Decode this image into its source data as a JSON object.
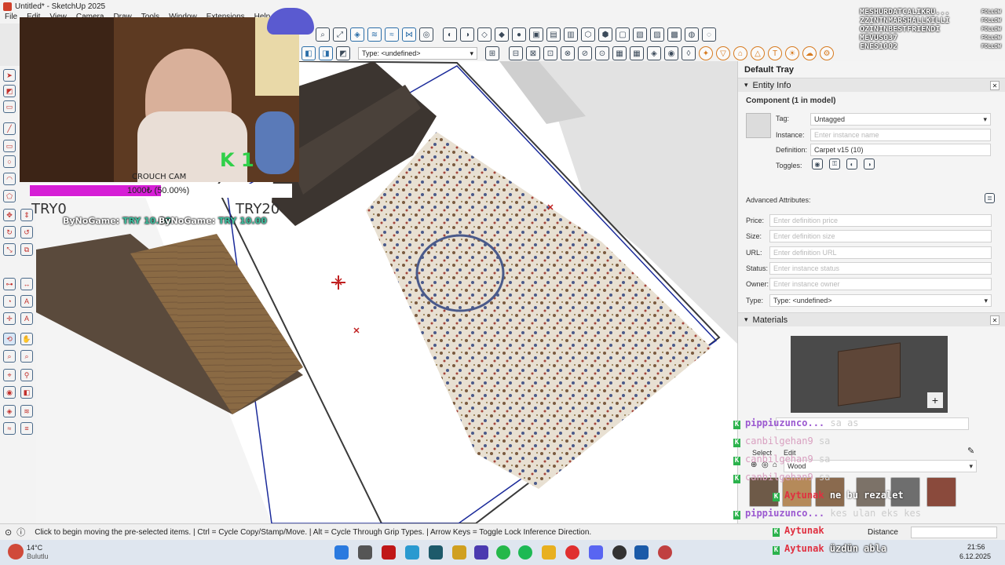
{
  "window": {
    "title": "Untitled* - SketchUp 2025",
    "menus": [
      "File",
      "Edit",
      "View",
      "Camera",
      "Draw",
      "Tools",
      "Window",
      "Extensions",
      "Help"
    ]
  },
  "toolbar": {
    "type_select": "Type: <undefined>"
  },
  "overlay": {
    "crouch_label": "CROUCH CAM",
    "progress_text": "1000₺ (50.00%)",
    "progress_fraction": 0.5,
    "bar_color": "#d61fd6",
    "k_counter": "K 1",
    "try_left": "TRY0",
    "try_right": "TRY20",
    "donation_1_name": "ByNoGame:",
    "donation_1_amount": "TRY 10.00",
    "donation_2_name": "ByNoGame:",
    "donation_2_amount": "TRY 10.00",
    "follow_list": [
      {
        "name": "MESHURDATCALIKRU...",
        "tag": "FOLLOW"
      },
      {
        "name": "ZZINTNMARSHALLKILLI",
        "tag": "FOLLOW"
      },
      {
        "name": "OZININBESTFRIENDI",
        "tag": "FOLLOW"
      },
      {
        "name": "MEVUS037",
        "tag": "FOLLOW"
      },
      {
        "name": "ENES1002",
        "tag": "FOLLOW"
      }
    ]
  },
  "tray": {
    "title": "Default Tray",
    "entity_info": {
      "header": "Entity Info",
      "component_label": "Component (1 in model)",
      "tag_label": "Tag:",
      "tag_value": "Untagged",
      "instance_label": "Instance:",
      "instance_placeholder": "Enter instance name",
      "definition_label": "Definition:",
      "definition_value": "Carpet v15 (10)",
      "toggles_label": "Toggles:",
      "advanced_label": "Advanced Attributes:",
      "price_label": "Price:",
      "price_placeholder": "Enter definition price",
      "size_label": "Size:",
      "size_placeholder": "Enter definition size",
      "url_label": "URL:",
      "url_placeholder": "Enter definition URL",
      "status_label": "Status:",
      "status_placeholder": "Enter instance status",
      "owner_label": "Owner:",
      "owner_placeholder": "Enter instance owner",
      "type_label": "Type:",
      "type_value": "Type: <undefined>"
    },
    "materials": {
      "header": "Materials",
      "select_tab": "Select",
      "edit_tab": "Edit",
      "library": "Wood",
      "swatch_colors": [
        "#6e5a48",
        "#b58a5a",
        "#8a6a4e",
        "#7c7268",
        "#6e6e6e",
        "#8a4a3c"
      ]
    }
  },
  "chat": [
    {
      "user": "pippiuzunco...",
      "msg": "sa as",
      "color": "#9b59d0"
    },
    {
      "user": "canbilgehan9",
      "msg": "sa",
      "color": "#d9a0c0"
    },
    {
      "user": "canbilgehan9",
      "msg": "sa",
      "color": "#d9a0c0"
    },
    {
      "user": "canbilgehan9",
      "msg": "sa",
      "color": "#d9a0c0"
    },
    {
      "user": "Aytunak",
      "msg": "ne bu rezalet",
      "color": "#e03040"
    },
    {
      "user": "pippiuzunco...",
      "msg": "kes ulan eks kes",
      "color": "#9b59d0"
    },
    {
      "user": "Aytunak",
      "msg": "",
      "color": "#e03040"
    },
    {
      "user": "Aytunak",
      "msg": "üzdün abla",
      "color": "#e03040"
    }
  ],
  "status": {
    "hint": "Click to begin moving the pre-selected items. | Ctrl = Cycle Copy/Stamp/Move. | Alt = Cycle Through Grip Types. | Arrow Keys = Toggle Lock Inference Direction.",
    "measure_label": "Distance"
  },
  "taskbar": {
    "weather_temp": "14°C",
    "weather_desc": "Bulutlu",
    "time": "21:56",
    "date": "6.12.2025"
  }
}
